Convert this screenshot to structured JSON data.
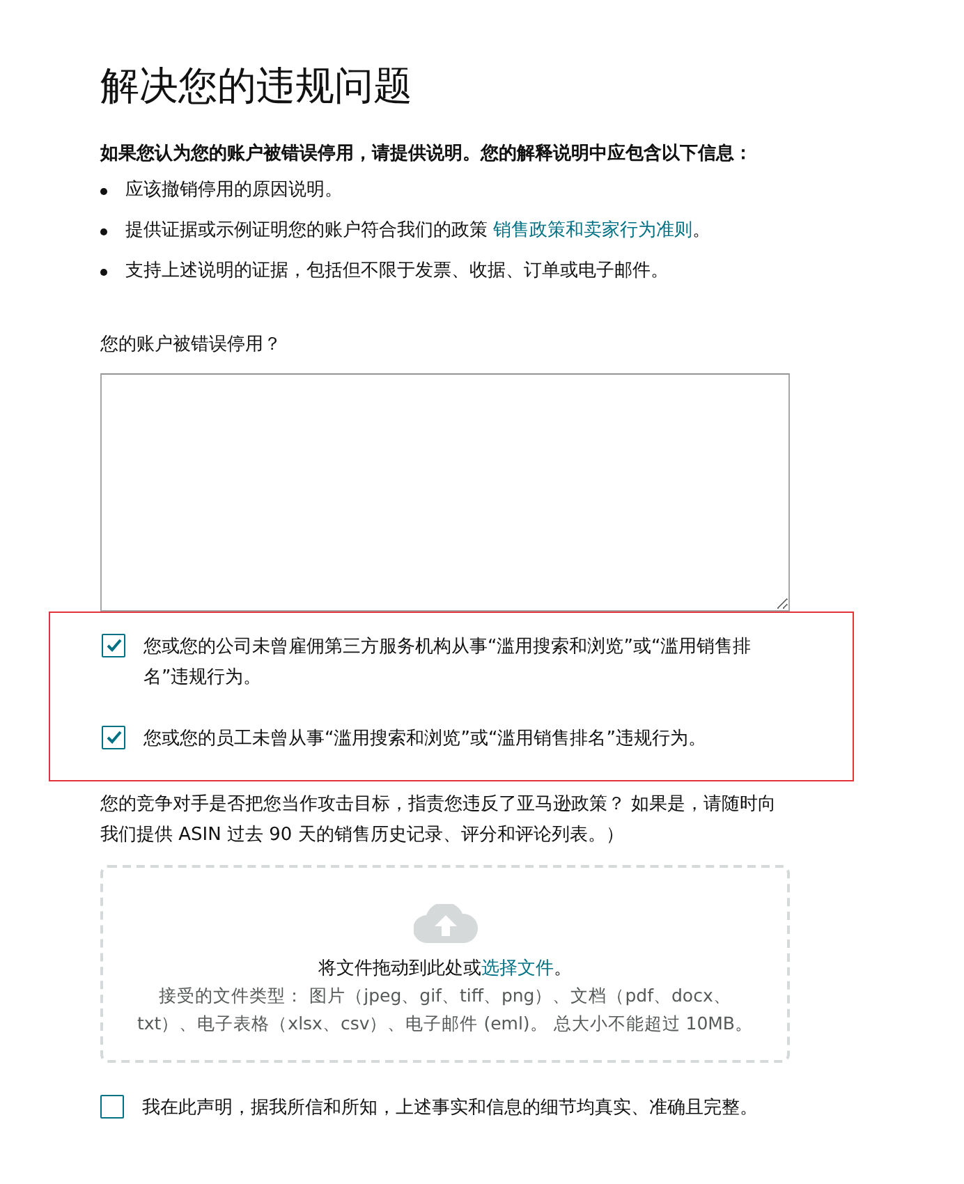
{
  "title": "解决您的违规问题",
  "intro": "如果您认为您的账户被错误停用，请提供说明。您的解释说明中应包含以下信息：",
  "bullets": [
    {
      "text": "应该撤销停用的原因说明。"
    },
    {
      "text": "提供证据或示例证明您的账户符合我们的政策 ",
      "link": "销售政策和卖家行为准则",
      "end": "。"
    },
    {
      "text": "支持上述说明的证据，包括但不限于发票、收据、订单或电子邮件。"
    }
  ],
  "question": "您的账户被错误停用？",
  "confirmations": {
    "highlighted": true,
    "items": [
      {
        "label": "您或您的公司未曾雇佣第三方服务机构从事“滥用搜索和浏览”或“滥用销售排名”违规行为。",
        "checked": true
      },
      {
        "label": "您或您的员工未曾从事“滥用搜索和浏览”或“滥用销售排名”违规行为。",
        "checked": true
      }
    ]
  },
  "competitor_note": "您的竞争对手是否把您当作攻击目标，指责您违反了亚马逊政策？ 如果是，请随时向我们提供 ASIN 过去 90 天的销售历史记录、评分和评论列表。）",
  "upload": {
    "prompt": "将文件拖动到此处或",
    "link": "选择文件",
    "prompt_end": "。",
    "accepted_types": "接受的文件类型： 图片（jpeg、gif、tiff、png）、文档（pdf、docx、txt）、电子表格（xlsx、csv）、电子邮件 (eml)。 总大小不能超过 10MB。"
  },
  "declaration": {
    "label": "我在此声明，据我所信和所知，上述事实和信息的细节均真实、准确且完整。",
    "checked": false
  }
}
